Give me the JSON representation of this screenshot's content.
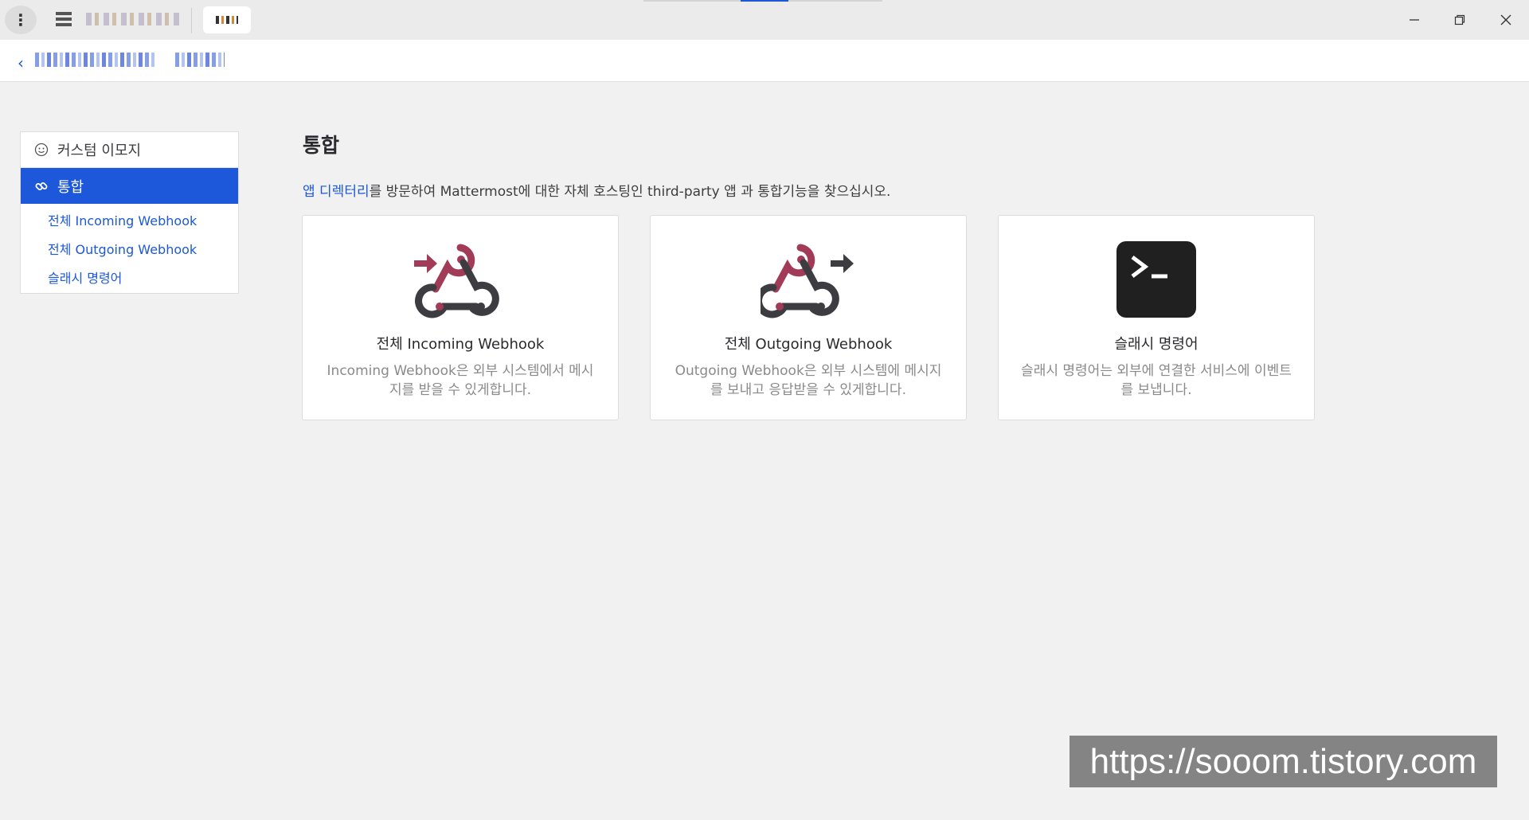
{
  "titlebar": {
    "menu_icon": "vertical-dots-icon",
    "window_controls": [
      "minimize-icon",
      "restore-icon",
      "close-icon"
    ]
  },
  "sidebar": {
    "items": [
      {
        "label": "커스텀 이모지",
        "icon": "smiley-icon"
      },
      {
        "label": "통합",
        "icon": "link-icon",
        "active": true
      }
    ],
    "subitems": [
      {
        "label": "전체 Incoming Webhook"
      },
      {
        "label": "전체 Outgoing Webhook"
      },
      {
        "label": "슬래시 명령어"
      }
    ]
  },
  "main": {
    "title": "통합",
    "intro_link": "앱 디렉터리",
    "intro_text": "를 방문하여 Mattermost에 대한 자체 호스팅인 third-party 앱 과 통합기능을 찾으십시오.",
    "cards": [
      {
        "title": "전체 Incoming Webhook",
        "desc": "Incoming Webhook은 외부 시스템에서 메시지를 받을 수 있게합니다.",
        "icon": "incoming-webhook-icon"
      },
      {
        "title": "전체 Outgoing Webhook",
        "desc": "Outgoing Webhook은 외부 시스템에 메시지를 보내고 응답받을 수 있게합니다.",
        "icon": "outgoing-webhook-icon"
      },
      {
        "title": "슬래시 명령어",
        "desc": "슬래시 명령어는 외부에 연결한 서비스에 이벤트를 보냅니다.",
        "icon": "terminal-icon"
      }
    ]
  },
  "colors": {
    "accent": "#1c58d9",
    "webhook_red": "#a13b58",
    "webhook_dark": "#3d3c40"
  },
  "watermark": "https://sooom.tistory.com"
}
